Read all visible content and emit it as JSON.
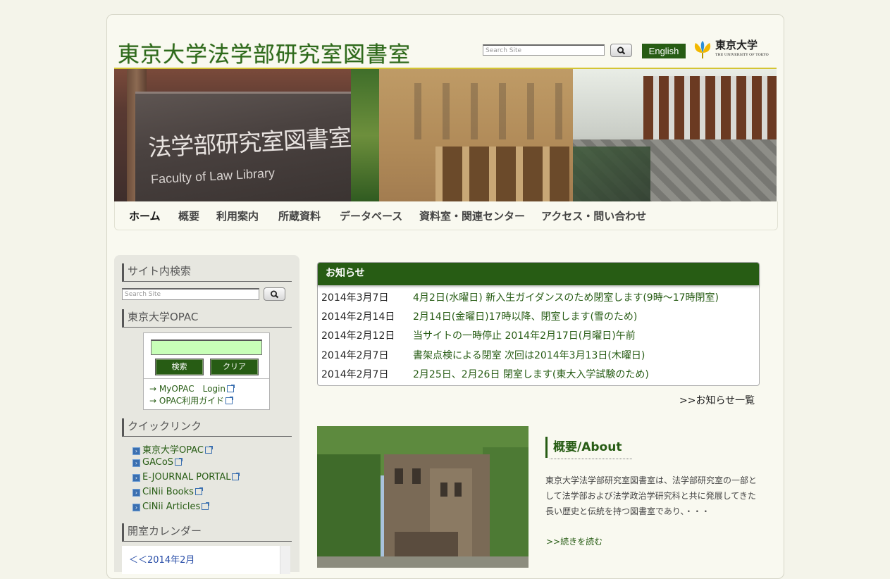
{
  "header": {
    "site_title": "東京大学法学部研究室図書室",
    "search_placeholder": "Search Site",
    "lang_button": "English",
    "univ_logo_text": "東京大学",
    "univ_logo_sub": "THE UNIVERSITY OF TOKYO"
  },
  "banner": {
    "sign_line1": "法学部研究室図書室",
    "sign_line2": "Faculty of Law Library"
  },
  "nav": {
    "items": [
      "ホーム",
      "概要",
      "利用案内",
      "所蔵資料",
      "データベース",
      "資料室・関連センター",
      "アクセス・問い合わせ"
    ]
  },
  "sidebar": {
    "site_search_heading": "サイト内検索",
    "search_placeholder": "Search Site",
    "opac_heading": "東京大学OPAC",
    "opac_search_button": "検索",
    "opac_clear_button": "クリア",
    "opac_links": [
      "→ MyOPAC　Login",
      "→ OPAC利用ガイド"
    ],
    "quicklink_heading": "クイックリンク",
    "quicklinks": [
      "東京大学OPAC",
      "GACoS",
      "E-JOURNAL PORTAL",
      "CiNii Books",
      "CiNii Articles"
    ],
    "calendar_heading": "開室カレンダー",
    "calendar_prev": "＜＜2014年2月"
  },
  "news": {
    "heading": "お知らせ",
    "items": [
      {
        "date": "2014年3月7日",
        "title": "4月2日(水曜日) 新入生ガイダンスのため閉室します(9時～17時閉室)"
      },
      {
        "date": "2014年2月14日",
        "title": "2月14日(金曜日)17時以降、閉室します(雪のため)"
      },
      {
        "date": "2014年2月12日",
        "title": "当サイトの一時停止 2014年2月17日(月曜日)午前"
      },
      {
        "date": "2014年2月7日",
        "title": "書架点検による閉室 次回は2014年3月13日(木曜日)"
      },
      {
        "date": "2014年2月7日",
        "title": "2月25日、2月26日 閉室します(東大入学試験のため)"
      }
    ],
    "more_link": ">>お知らせ一覧"
  },
  "about": {
    "title": "概要/About",
    "text": "東京大学法学部研究室図書室は、法学部研究室の一部として法学部および法学政治学研究科と共に発展してきた長い歴史と伝統を持つ図書室であり、・・・",
    "more_link": ">>続きを読む"
  },
  "colors": {
    "accent_green": "#275c14",
    "banner_border": "#d4c534"
  }
}
